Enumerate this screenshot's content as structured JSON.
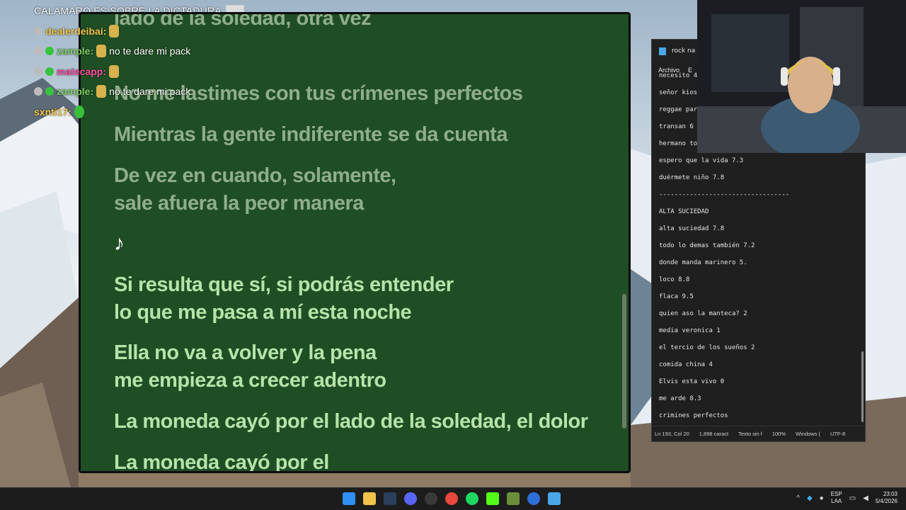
{
  "stream": {
    "title": "CALAMARO ES SOBRE LA DICTADURA"
  },
  "chat": [
    {
      "user": "dealerdeibai:",
      "user_color": "#f2c94c",
      "message": ""
    },
    {
      "user": "zample:",
      "user_color": "#7ecf6a",
      "message": "no te dare mi pack"
    },
    {
      "user": "matecapp:",
      "user_color": "#ff4fa3",
      "message": ""
    },
    {
      "user": "zample:",
      "user_color": "#7ecf6a",
      "message": "no te dare mi pack"
    },
    {
      "user": "sxnti17:",
      "user_color": "#f2c94c",
      "message": ""
    }
  ],
  "lyrics": {
    "lines": [
      {
        "text": "lado de la soledad, otra vez",
        "state": "past"
      },
      {
        "text": "No me lastimes con tus crímenes perfectos",
        "state": "past"
      },
      {
        "text": "Mientras la gente indiferente se da cuenta",
        "state": "past"
      },
      {
        "text": "De vez en cuando, solamente,",
        "state": "past"
      },
      {
        "text": "sale afuera la peor manera",
        "state": "past"
      },
      {
        "text": "♪",
        "state": "note"
      },
      {
        "text": "Si resulta que sí, si podrás entender",
        "state": "future"
      },
      {
        "text": "lo que me pasa a mí esta noche",
        "state": "future"
      },
      {
        "text": "Ella no va a volver y la pena",
        "state": "future"
      },
      {
        "text": "me empieza a crecer adentro",
        "state": "future"
      },
      {
        "text": "La moneda cayó por el lado de la soledad, el dolor",
        "state": "future"
      },
      {
        "text": "La moneda cayó por el",
        "state": "future"
      }
    ],
    "colors": {
      "background": "#1f4d24",
      "past": "#8fae8a",
      "future": "#b6e3a9"
    }
  },
  "notepad": {
    "tab_title": "rock na",
    "menu": [
      "Archivo",
      "E"
    ],
    "lines": [
      "necesito 4",
      "señor kios",
      "reggae par",
      "transan 6",
      "hermano to",
      "espero que la vida 7.3",
      "duérmete niño 7.8",
      "----------------------------------",
      "ALTA SUCIEDAD",
      "alta suciedad 7.8",
      "todo lo demas también 7.2",
      "donde manda marinero 5.",
      "loco 8.8",
      "flaca 9.5",
      "quien aso la manteca? 2",
      "media veronica 1",
      "el tercio de los sueños 2",
      "comida china 4",
      "Elvis esta vivo  0",
      "me arde 8.3",
      "crimines perfectos"
    ],
    "status": {
      "position": "Ln 193, Col 20",
      "chars": "1,898 caract",
      "format": "Texto sin f",
      "zoom": "100%",
      "line_ending": "Windows (",
      "encoding": "UTF-8"
    }
  },
  "taskbar": {
    "apps": [
      {
        "icon": "windows-start-icon",
        "color": "#2f8ff3"
      },
      {
        "icon": "file-explorer-icon",
        "color": "#f0c34a"
      },
      {
        "icon": "steam-icon",
        "color": "#1b2838"
      },
      {
        "icon": "discord-icon",
        "color": "#5865f2"
      },
      {
        "icon": "obs-icon",
        "color": "#3a3a3a"
      },
      {
        "icon": "chrome-icon",
        "color": "#e7483b"
      },
      {
        "icon": "spotify-icon",
        "color": "#1ed760"
      },
      {
        "icon": "kick-icon",
        "color": "#53fc18"
      },
      {
        "icon": "minecraft-icon",
        "color": "#6b8e3a"
      },
      {
        "icon": "ccleaner-icon",
        "color": "#2d6fd8"
      },
      {
        "icon": "notepad-icon",
        "color": "#4aa6e8"
      }
    ],
    "lang_top": "ESP",
    "lang_bottom": "LAA",
    "time": "23:03",
    "date": "5/4/2026"
  }
}
